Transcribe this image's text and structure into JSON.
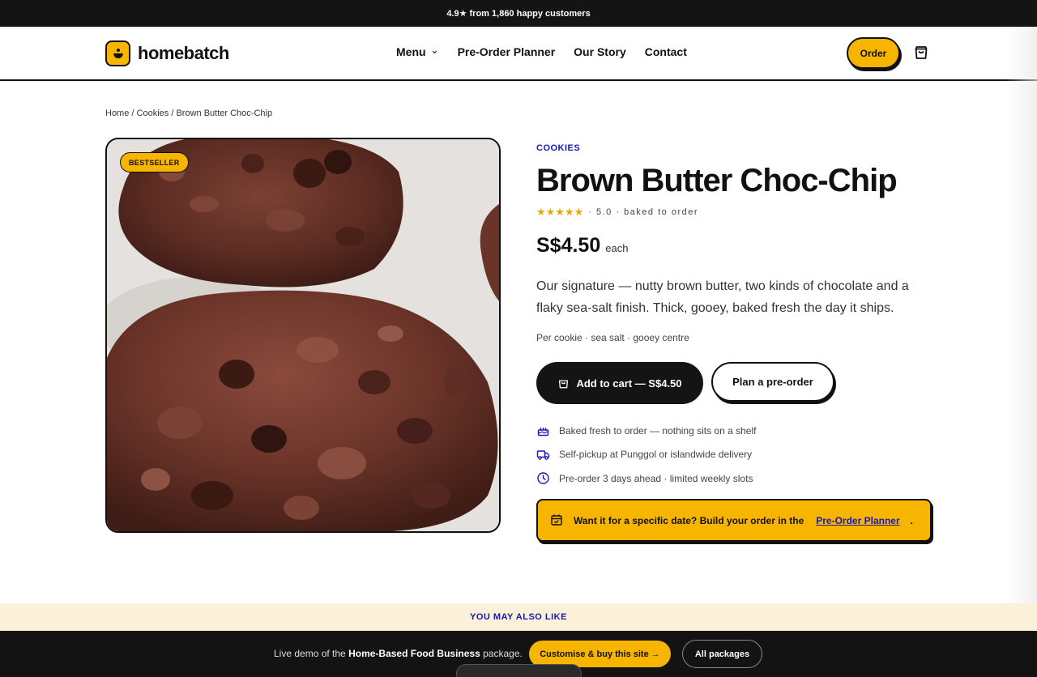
{
  "announcement": {
    "text": "4.9★ from 1,860 happy customers"
  },
  "header": {
    "brand": "homebatch",
    "nav": {
      "menu": "Menu",
      "preorder_planner": "Pre-Order Planner",
      "our_story": "Our Story",
      "contact": "Contact"
    },
    "order_label": "Order"
  },
  "breadcrumb": {
    "home": "Home",
    "sep1": "/",
    "cookies": "Cookies",
    "sep2": "/",
    "current": "Brown Butter Choc-Chip"
  },
  "product": {
    "badge": "BESTSELLER",
    "category": "COOKIES",
    "title": "Brown Butter Choc-Chip",
    "stars": "★★★★★",
    "rating_text": "· 5.0 · baked to order",
    "rating_value": 5.0,
    "price": "S$4.50",
    "price_unit": "each",
    "description": "Our signature — nutty brown butter, two kinds of chocolate and a flaky sea-salt finish. Thick, gooey, baked fresh the day it ships.",
    "meta": "Per cookie · sea salt · gooey centre",
    "add_to_cart": "Add to cart — S$4.50",
    "plan_preorder": "Plan a pre-order",
    "features": [
      {
        "icon": "cake-icon",
        "text": "Baked fresh to order — nothing sits on a shelf"
      },
      {
        "icon": "truck-icon",
        "text": "Self-pickup at Punggol or islandwide delivery"
      },
      {
        "icon": "clock-icon",
        "text": "Pre-order 3 days ahead · limited weekly slots"
      }
    ],
    "callout": {
      "text": "Want it for a specific date? Build your order in the",
      "link": "Pre-Order Planner",
      "end": "."
    }
  },
  "related": {
    "heading": "YOU MAY ALSO LIKE"
  },
  "demo_bar": {
    "prefix": "Live demo of the",
    "package": "Home-Based Food Business",
    "suffix": "package.",
    "buy": "Customise & buy this site →",
    "all_packages": "All packages"
  },
  "colors": {
    "accent": "#f7b500",
    "link": "#1a1aa8",
    "dark": "#141414",
    "cream": "#fbf0da"
  }
}
